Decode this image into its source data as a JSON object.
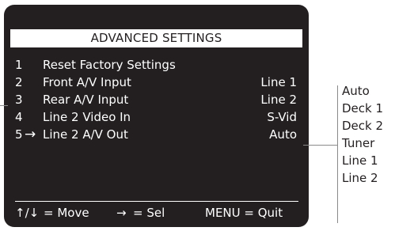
{
  "menu": {
    "title": "ADVANCED SETTINGS",
    "items": [
      {
        "number": "1",
        "label": "Reset Factory Settings",
        "value": ""
      },
      {
        "number": "2",
        "label": "Front A/V Input",
        "value": "Line 1"
      },
      {
        "number": "3",
        "label": "Rear A/V Input",
        "value": "Line 2"
      },
      {
        "number": "4",
        "label": "Line 2 Video In",
        "value": "S-Vid"
      },
      {
        "number": "5",
        "label": "Line 2 A/V Out",
        "value": "Auto",
        "selected": true,
        "cursor": "→"
      }
    ]
  },
  "footer": {
    "move_arrows": "↑/↓",
    "move_text": "= Move",
    "sel_arrow": "→",
    "sel_text": "= Sel",
    "quit_text": "MENU = Quit"
  },
  "options": [
    "Auto",
    "Deck 1",
    "Deck 2",
    "Tuner",
    "Line 1",
    "Line 2"
  ],
  "colors": {
    "screen": "#231f20",
    "text_on_screen": "#ffffff",
    "header_bg": "#ffffff",
    "callout_line": "#8a8a8a"
  }
}
